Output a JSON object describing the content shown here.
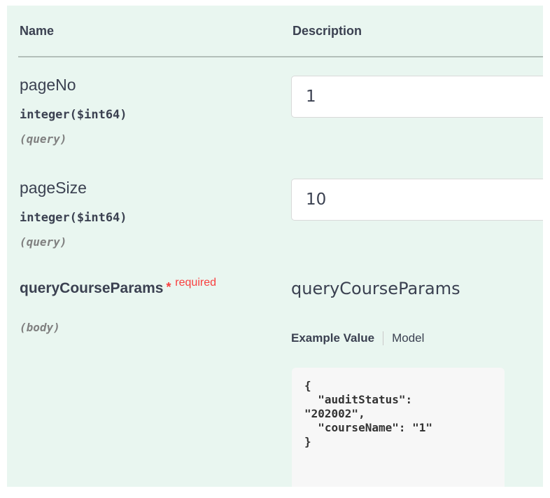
{
  "table": {
    "headers": {
      "name": "Name",
      "description": "Description"
    }
  },
  "parameters": [
    {
      "name": "pageNo",
      "type": "integer($int64)",
      "in": "(query)",
      "value": "1"
    },
    {
      "name": "pageSize",
      "type": "integer($int64)",
      "in": "(query)",
      "value": "10"
    }
  ],
  "body_param": {
    "name": "queryCourseParams",
    "required_star": "*",
    "required_label": "required",
    "in": "(body)",
    "schema_title": "queryCourseParams",
    "tabs": {
      "example_value": "Example Value",
      "model": "Model"
    },
    "example_json": "{\n  \"auditStatus\":\n\"202002\",\n  \"courseName\": \"1\"\n}"
  },
  "colors": {
    "panel_background": "#e9f6f0",
    "text": "#3b4151",
    "required": "#f93e3e"
  }
}
